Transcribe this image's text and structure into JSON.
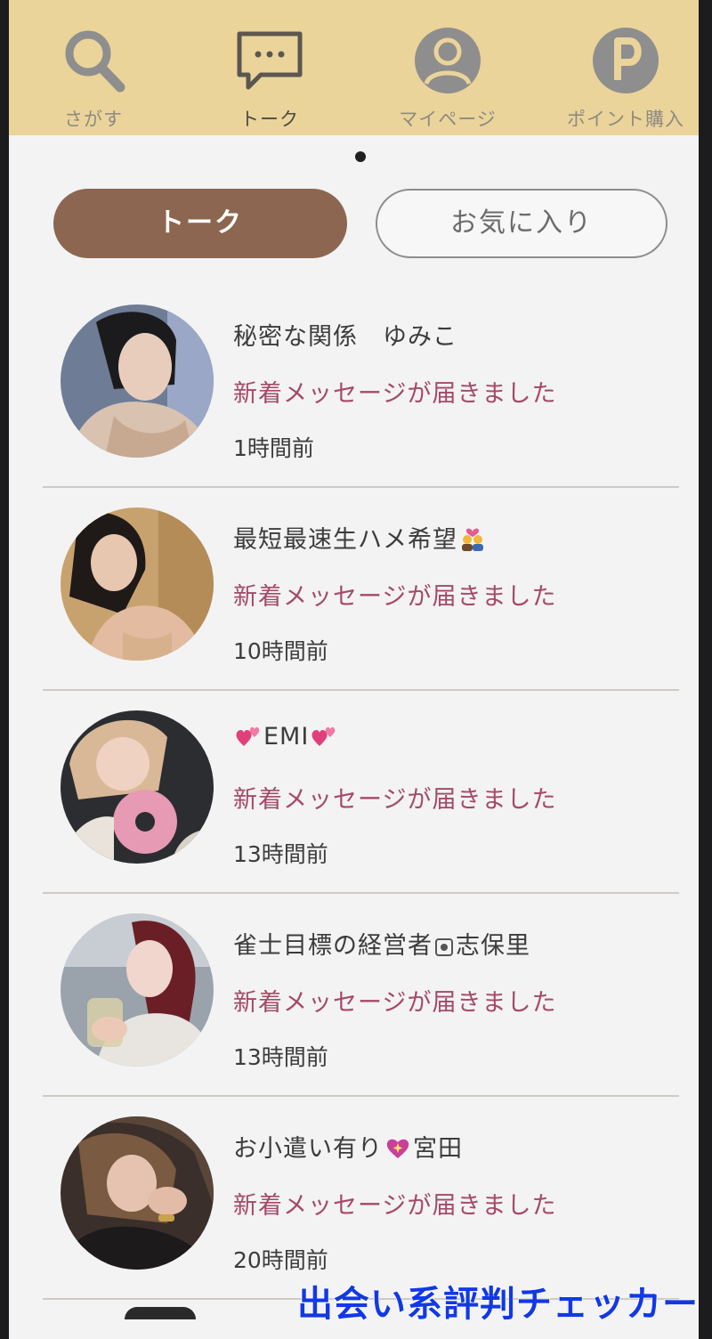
{
  "nav": {
    "items": [
      {
        "label": "さがす",
        "icon": "search-icon"
      },
      {
        "label": "トーク",
        "icon": "chat-bubble-icon"
      },
      {
        "label": "マイページ",
        "icon": "user-icon"
      },
      {
        "label": "ポイント購入",
        "icon": "points-p-icon"
      }
    ],
    "active_index": 1
  },
  "tabs": {
    "talk": "トーク",
    "favorites": "お気に入り",
    "selected": "talk"
  },
  "talks": [
    {
      "name": "秘密な関係　ゆみこ",
      "message": "新着メッセージが届きました",
      "time": "1時間前"
    },
    {
      "name": "最短最速生ハメ希望",
      "name_emoji": "couple-with-heart-emoji",
      "message": "新着メッセージが届きました",
      "time": "10時間前"
    },
    {
      "name": "EMI",
      "name_emoji": "two-hearts-emoji",
      "message": "新着メッセージが届きました",
      "time": "13時間前"
    },
    {
      "name_part1": "雀士目標の経営者",
      "name_part2": "志保里",
      "name_emoji": "ballot-box-emoji",
      "message": "新着メッセージが届きました",
      "time": "13時間前"
    },
    {
      "name_part1": "お小遣い有り",
      "name_part2": "宮田",
      "name_emoji": "sparkling-heart-emoji",
      "message": "新着メッセージが届きました",
      "time": "20時間前"
    }
  ],
  "colors": {
    "header_bg": "#ead49a",
    "tab_active_bg": "#8c6650",
    "message_text": "#a54a66",
    "watermark": "#1238e6"
  },
  "watermark": "出会い系評判チェッカー"
}
